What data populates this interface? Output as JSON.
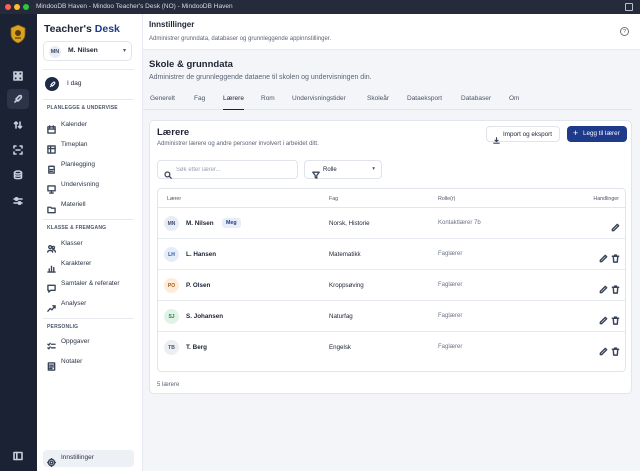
{
  "window": {
    "title": "MindooDB Haven - Mindoo Teacher's Desk (NO) - MindooDB Haven"
  },
  "brand": {
    "part1": "Teacher's",
    "part2": "Desk"
  },
  "user": {
    "initials": "MN",
    "name": "M. Nilsen"
  },
  "today": {
    "label": "I dag"
  },
  "sections": {
    "plan": "PLANLEGGE & UNDERVISE",
    "class": "KLASSE & FREMGANG",
    "personal": "PERSONLIG"
  },
  "nav": {
    "plan": [
      "Kalender",
      "Timeplan",
      "Planlegging",
      "Undervisning",
      "Materiell"
    ],
    "class": [
      "Klasser",
      "Karakterer",
      "Samtaler & referater",
      "Analyser"
    ],
    "personal": [
      "Oppgaver",
      "Notater"
    ],
    "settings": "Innstillinger"
  },
  "header": {
    "title": "Innstillinger",
    "subtitle": "Administrer grunndata, databaser og grunnleggende appinnstillinger.",
    "help": "?"
  },
  "section": {
    "title": "Skole & grunndata",
    "subtitle": "Administrer de grunnleggende dataene til skolen og undervisningen din."
  },
  "tabs": [
    "Generelt",
    "Fag",
    "Lærere",
    "Rom",
    "Undervisningstider",
    "Skoleår",
    "Dataeksport",
    "Databaser",
    "Om"
  ],
  "active_tab": "Lærere",
  "card": {
    "title": "Lærere",
    "subtitle": "Administrer lærere og andre personer involvert i arbeidet ditt.",
    "import_label": "Import og eksport",
    "add_label": "Legg til lærer",
    "search_placeholder": "Søk etter lærer...",
    "role_filter": "Rolle",
    "columns": {
      "teacher": "Lærer",
      "subject": "Fag",
      "role": "Rolle(r)",
      "actions": "Handlinger"
    },
    "rows": [
      {
        "initials": "MN",
        "name": "M. Nilsen",
        "badge": "Meg",
        "subject": "Norsk, Historie",
        "role": "Kontaktlærer 7b",
        "avatar_bg": "#e8ecf5",
        "avatar_fg": "#3f4c6b"
      },
      {
        "initials": "LH",
        "name": "L. Hansen",
        "badge": "",
        "subject": "Matematikk",
        "role": "Faglærer",
        "avatar_bg": "#e5edfb",
        "avatar_fg": "#2f4f8f"
      },
      {
        "initials": "PO",
        "name": "P. Olsen",
        "badge": "",
        "subject": "Kroppsøving",
        "role": "Faglærer",
        "avatar_bg": "#fdecd9",
        "avatar_fg": "#a05a1a"
      },
      {
        "initials": "SJ",
        "name": "S. Johansen",
        "badge": "",
        "subject": "Naturfag",
        "role": "Faglærer",
        "avatar_bg": "#e1f3e6",
        "avatar_fg": "#2e7a45"
      },
      {
        "initials": "TB",
        "name": "T. Berg",
        "badge": "",
        "subject": "Engelsk",
        "role": "Faglærer",
        "avatar_bg": "#eceef2",
        "avatar_fg": "#4b5568"
      }
    ],
    "count": "5 lærere"
  },
  "colors": {
    "accent": "#1e3a8a",
    "rail": "#1b2233",
    "background": "#f3f5f8"
  }
}
